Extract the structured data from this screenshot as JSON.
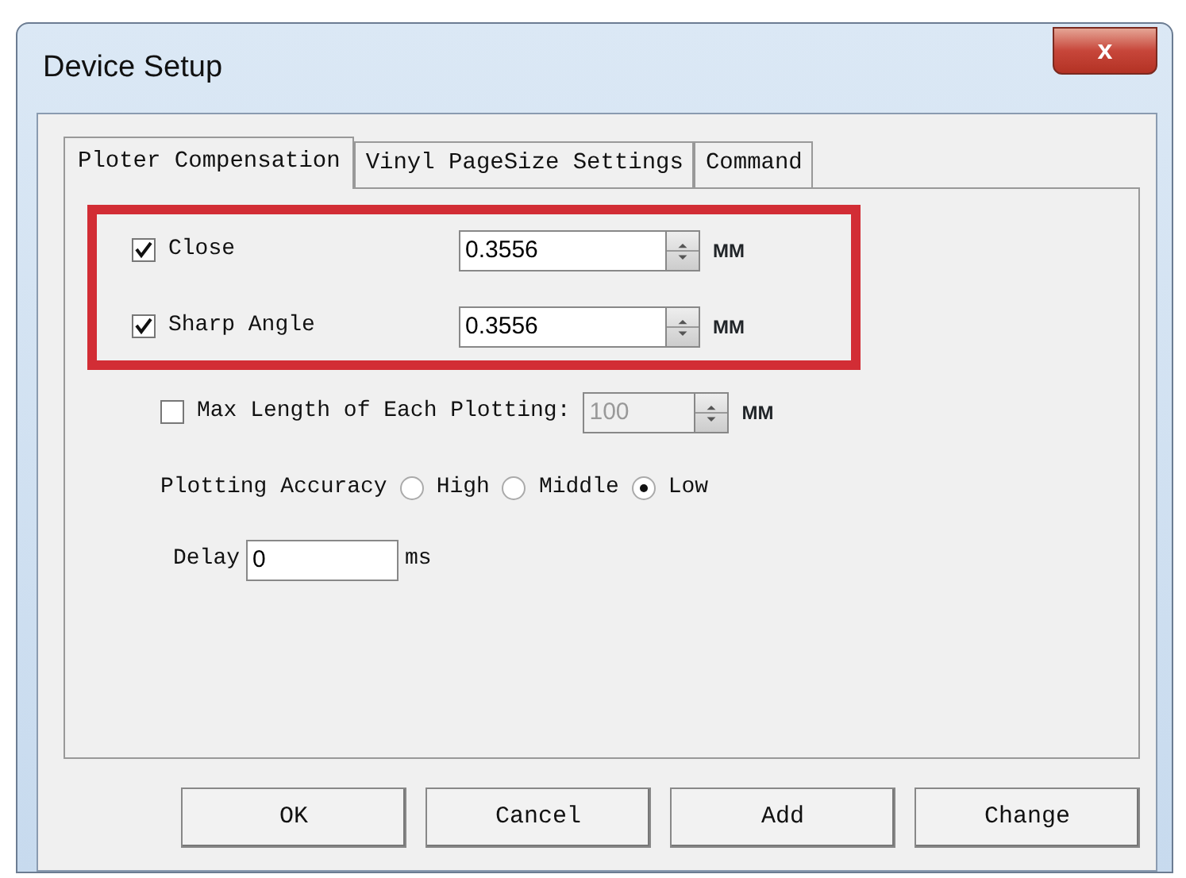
{
  "window": {
    "title": "Device Setup",
    "close": "x"
  },
  "tabs": [
    {
      "label": "Ploter Compensation",
      "selected": true
    },
    {
      "label": "Vinyl PageSize Settings",
      "selected": false
    },
    {
      "label": "Command",
      "selected": false
    }
  ],
  "compensation": {
    "highlighted": true,
    "rows": [
      {
        "label": "Close",
        "checked": true,
        "value": "0.3556",
        "unit": "MM"
      },
      {
        "label": "Sharp Angle",
        "checked": true,
        "value": "0.3556",
        "unit": "MM"
      }
    ]
  },
  "max_length": {
    "label": "Max Length of Each Plotting:",
    "checked": false,
    "value": "100",
    "unit": "MM",
    "disabled": true
  },
  "accuracy": {
    "label": "Plotting Accuracy",
    "options": [
      {
        "label": "High",
        "selected": false
      },
      {
        "label": "Middle",
        "selected": false
      },
      {
        "label": "Low",
        "selected": true
      }
    ]
  },
  "delay": {
    "label": "Delay",
    "value": "0",
    "unit": "ms"
  },
  "buttons": [
    "OK",
    "Cancel",
    "Add",
    "Change"
  ]
}
